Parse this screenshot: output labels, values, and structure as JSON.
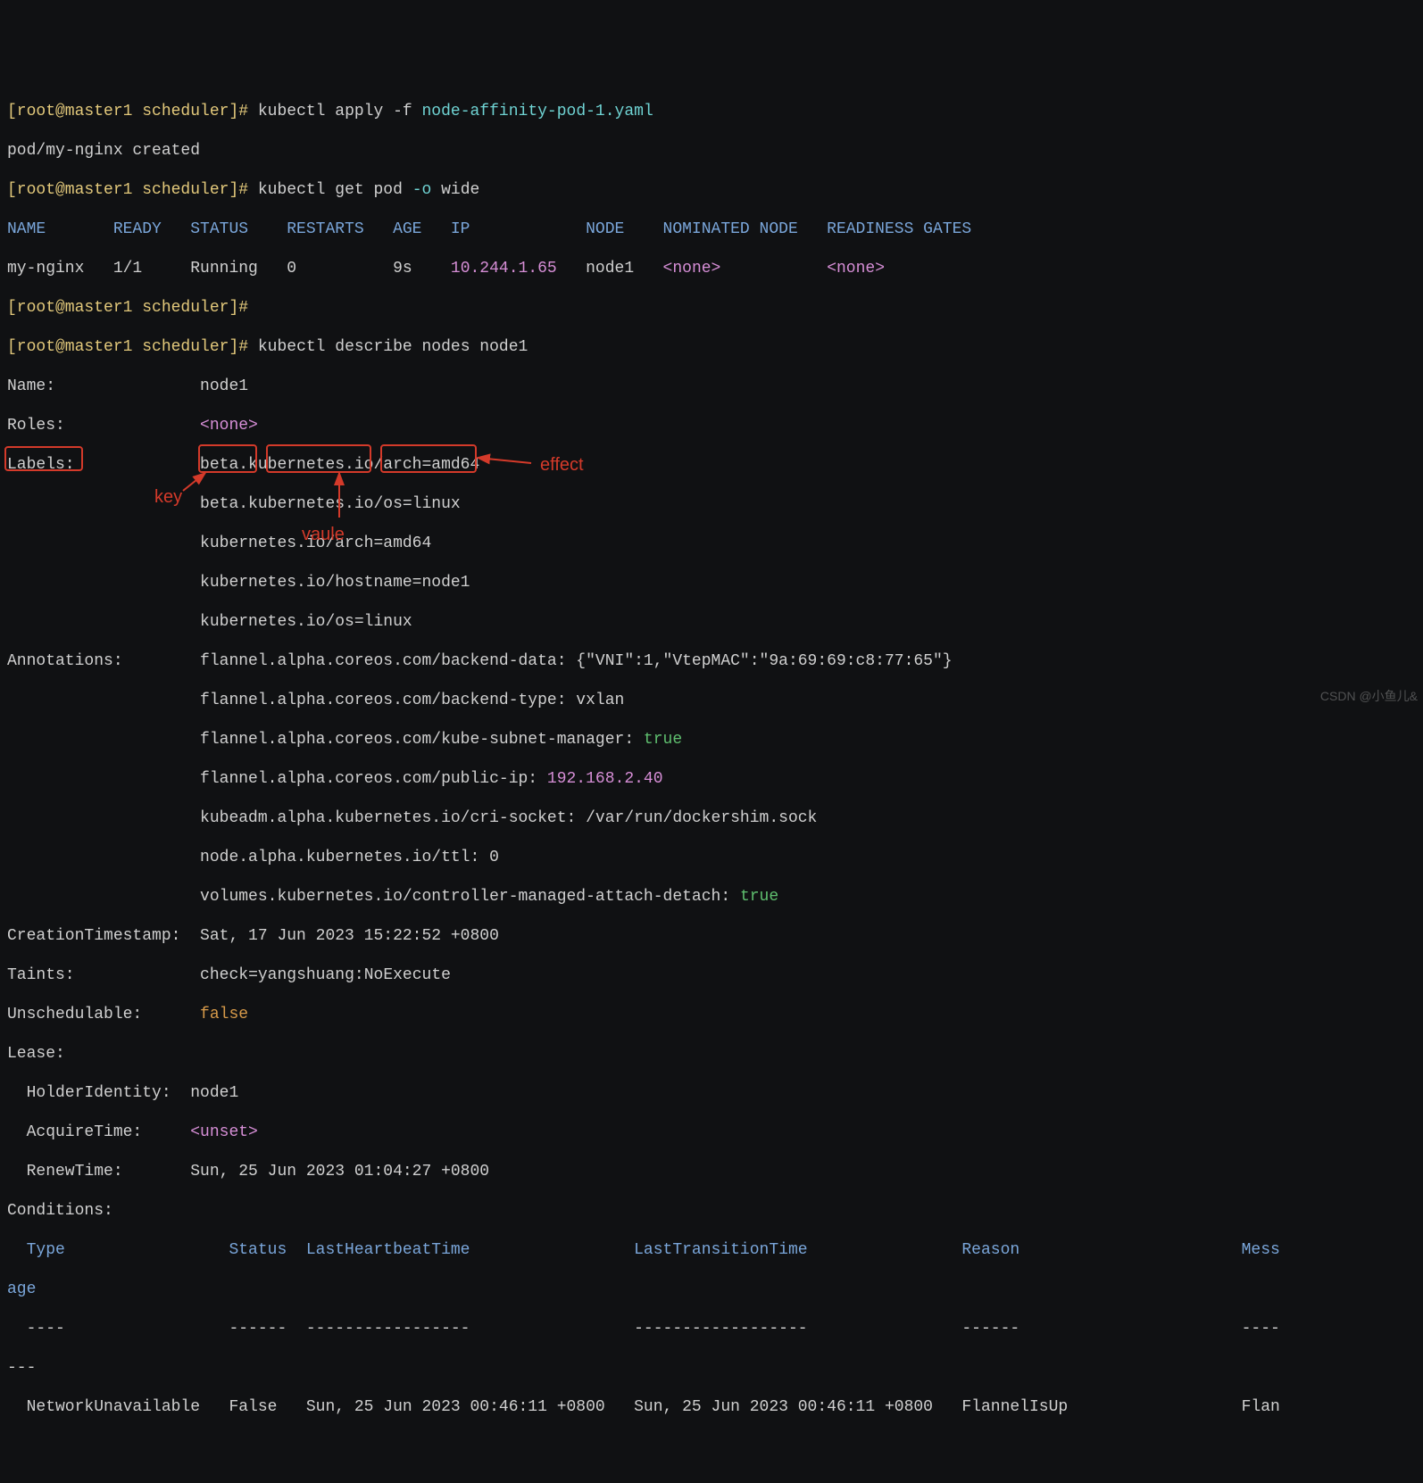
{
  "prompt": {
    "full_prefix": "[root@master1 scheduler]#"
  },
  "cmd1": {
    "command": "kubectl apply -f ",
    "file": "node-affinity-pod-1.yaml"
  },
  "out1": "pod/my-nginx created",
  "cmd2": {
    "command": "kubectl get pod ",
    "flag": "-o",
    "arg": " wide"
  },
  "table": {
    "header": "NAME       READY   STATUS    RESTARTS   AGE   IP            NODE    NOMINATED NODE   READINESS GATES",
    "row_left": "my-nginx   1/1     Running   0          9s    ",
    "ip": "10.244.1.65",
    "row_mid": "   node1   ",
    "none1": "<none>",
    "row_gap": "           ",
    "none2": "<none>"
  },
  "cmd3_blank": "",
  "cmd3": "kubectl describe nodes node1",
  "name": "Name:               node1",
  "roles_l": "Roles:              ",
  "roles_v": "<none>",
  "labels_head": "Labels:             beta.kubernetes.io/arch=amd64",
  "labels_2": "                    beta.kubernetes.io/os=linux",
  "labels_3": "                    kubernetes.io/arch=amd64",
  "labels_4": "                    kubernetes.io/hostname=node1",
  "labels_5": "                    kubernetes.io/os=linux",
  "anno_1": "Annotations:        flannel.alpha.coreos.com/backend-data: {\"VNI\":1,\"VtepMAC\":\"9a:69:69:c8:77:65\"}",
  "anno_2": "                    flannel.alpha.coreos.com/backend-type: vxlan",
  "anno_3_l": "                    flannel.alpha.coreos.com/kube-subnet-manager: ",
  "anno_3_v": "true",
  "anno_4_l": "                    flannel.alpha.coreos.com/public-ip: ",
  "anno_4_v": "192.168.2.40",
  "anno_5": "                    kubeadm.alpha.kubernetes.io/cri-socket: /var/run/dockershim.sock",
  "anno_6": "                    node.alpha.kubernetes.io/ttl: 0",
  "anno_7_l": "                    volumes.kubernetes.io/controller-managed-attach-detach: ",
  "anno_7_v": "true",
  "ctime": "CreationTimestamp:  Sat, 17 Jun 2023 15:22:52 +0800",
  "taints_l": "Taints:             ",
  "taints_key": "check",
  "taints_eq": "=",
  "taints_val": "yangshuang",
  "taints_col": ":",
  "taints_eff": "NoExecute",
  "unsched_l": "Unschedulable:      ",
  "unsched_v": "false",
  "lease": "Lease:",
  "holder": "  HolderIdentity:  node1",
  "acq_l": "  AcquireTime:     ",
  "acq_v": "<unset>",
  "renew": "  RenewTime:       Sun, 25 Jun 2023 01:04:27 +0800",
  "conds": "Conditions:",
  "cond_hdr1": "  Type                 Status  LastHeartbeatTime                 LastTransitionTime                Reason                       Mess",
  "cond_hdr2": "age",
  "cond_sep1": "  ----                 ------  -----------------                 ------------------                ------                       ----",
  "cond_sep2": "---",
  "cond_row": "  NetworkUnavailable   False   Sun, 25 Jun 2023 00:46:11 +0800   Sun, 25 Jun 2023 00:46:11 +0800   FlannelIsUp                  Flan",
  "annotations": {
    "key": "key",
    "value": "vaule",
    "effect": "effect"
  },
  "watermark": "CSDN @小鱼儿&"
}
